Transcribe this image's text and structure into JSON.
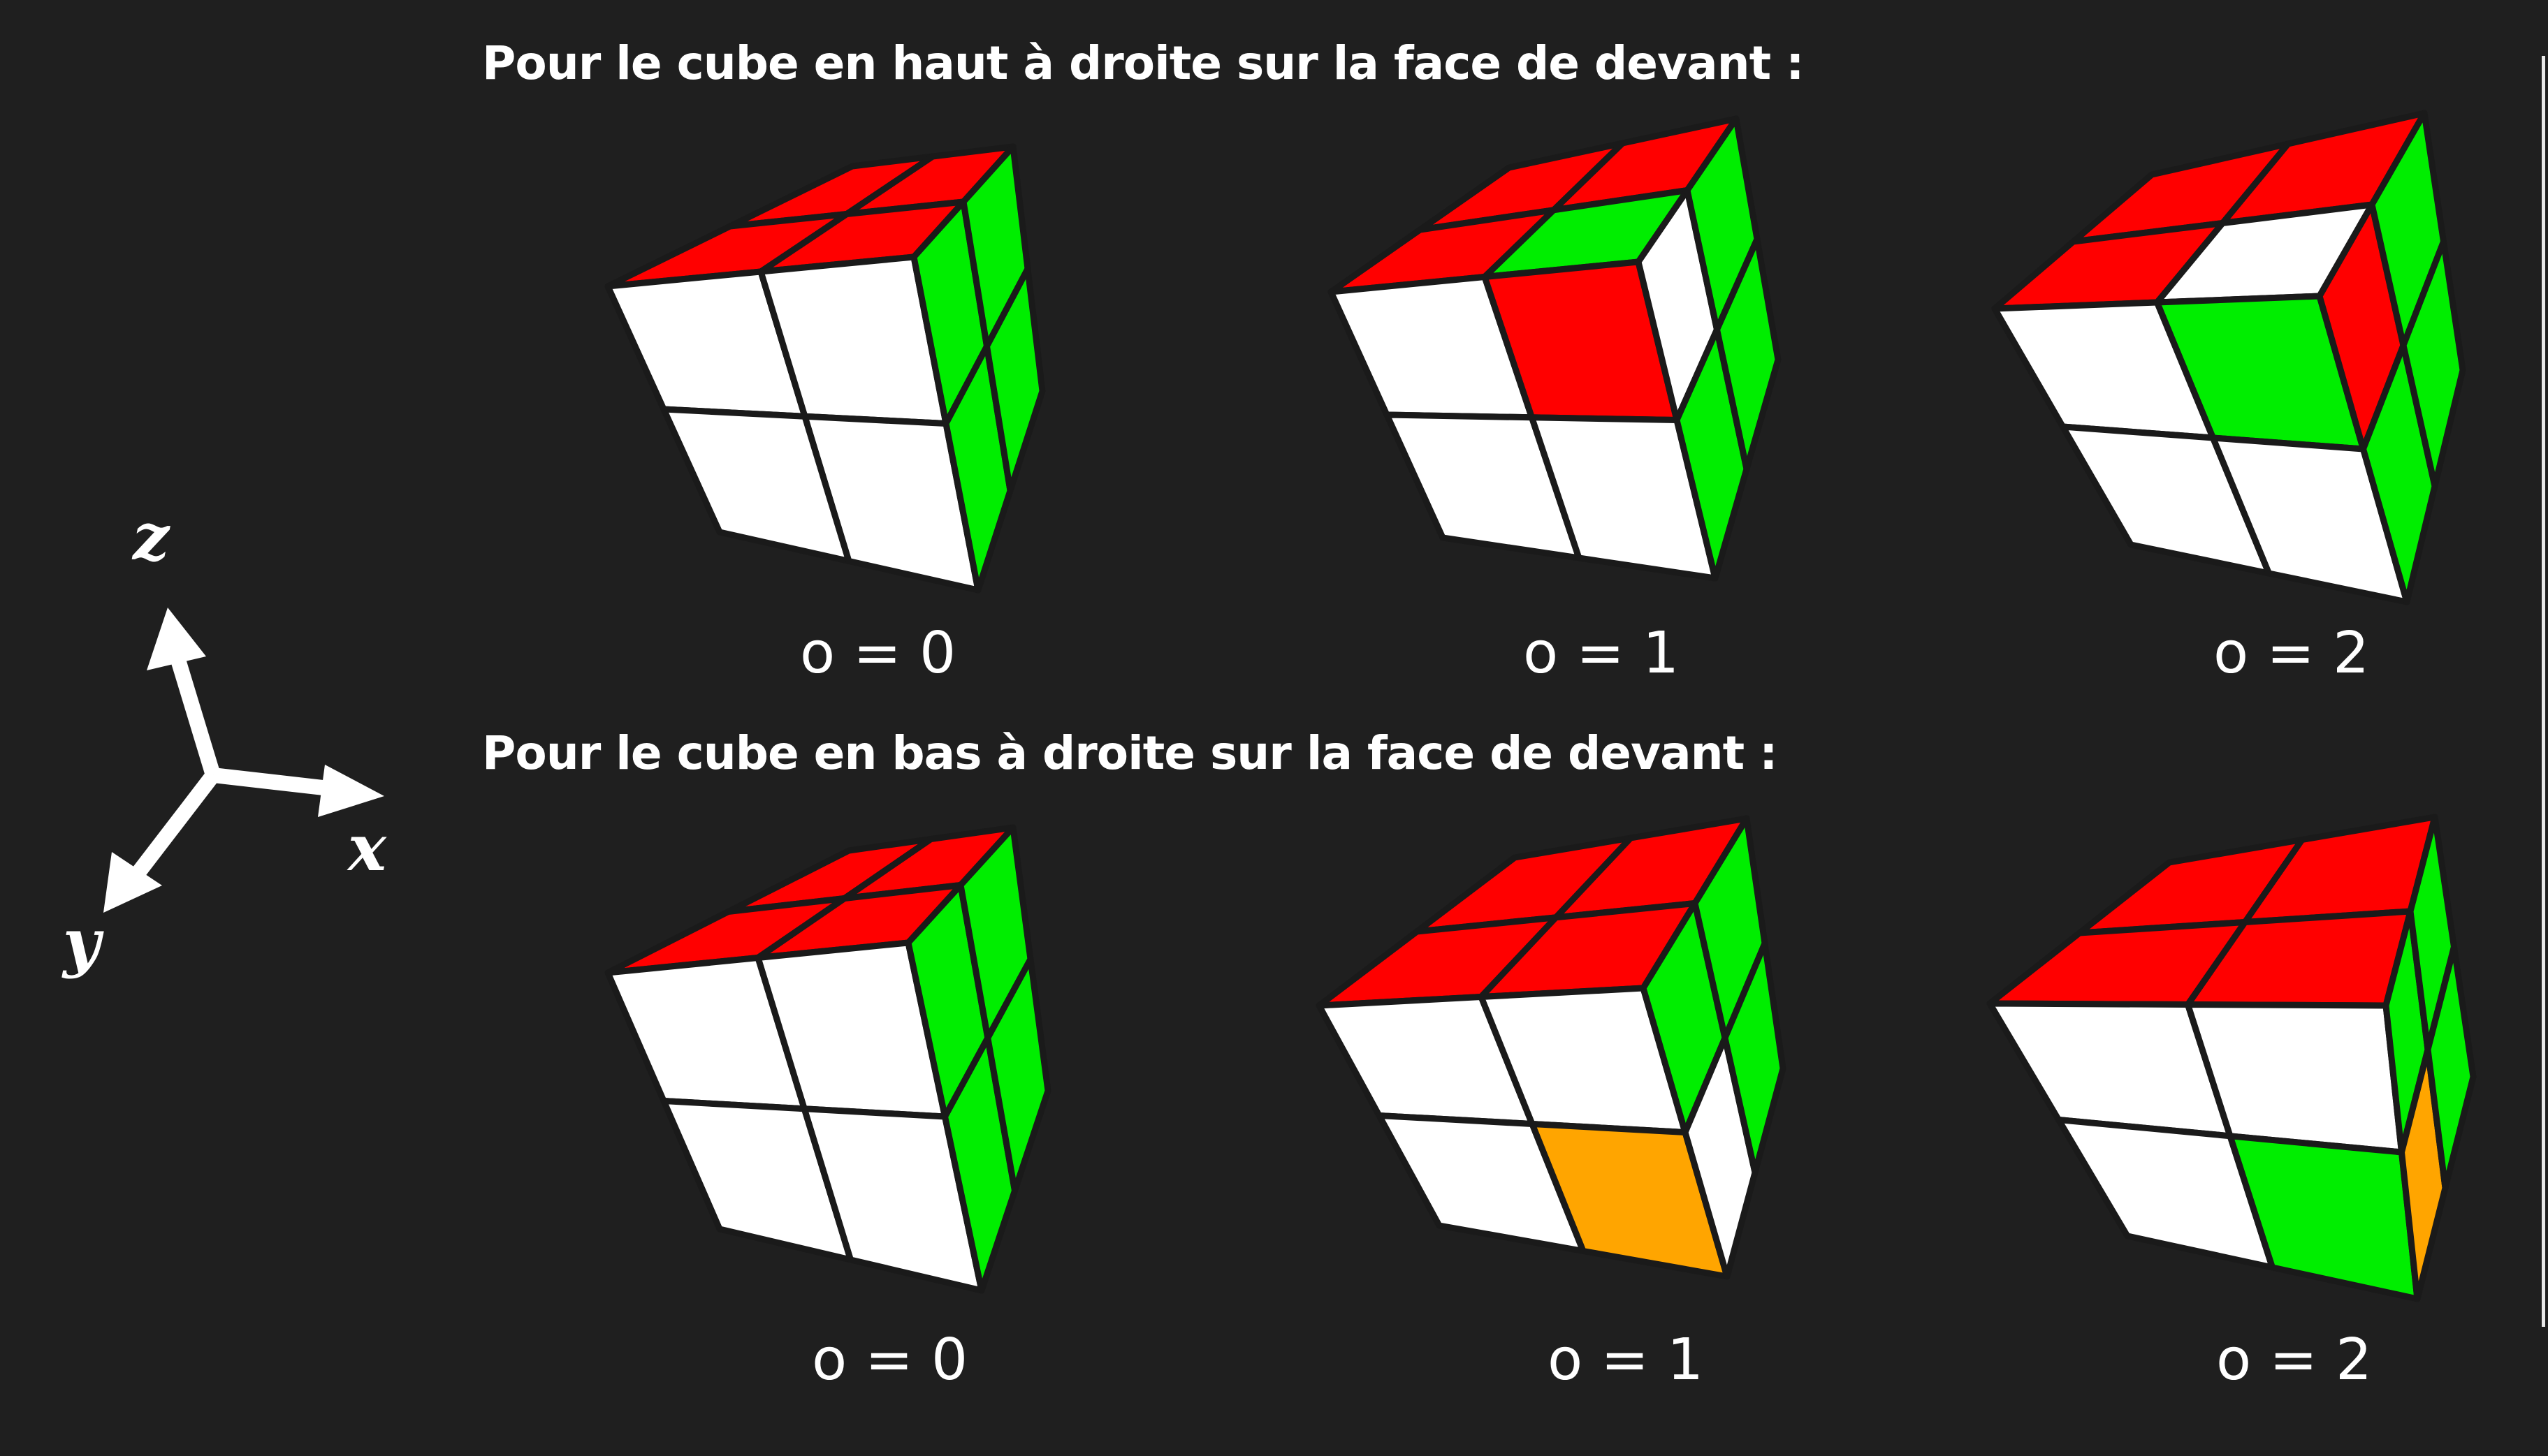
{
  "heading_top": "Pour le cube en haut à droite sur la face de devant :",
  "heading_bottom": "Pour le cube en bas à droite sur la face de devant :",
  "axes": {
    "x": "x",
    "y": "y",
    "z": "z"
  },
  "colors": {
    "red": "#ff0000",
    "green": "#00ee00",
    "white": "#ffffff",
    "orange": "#ffa500",
    "edge": "#1a1a1a"
  },
  "cubes": [
    {
      "label": "o = 0",
      "top": [
        "red",
        "red",
        "red",
        "red"
      ],
      "front": [
        "white",
        "white",
        "white",
        "white"
      ],
      "right": [
        "green",
        "green",
        "green",
        "green"
      ]
    },
    {
      "label": "o = 1",
      "top": [
        "red",
        "red",
        "red",
        "green"
      ],
      "front": [
        "white",
        "red",
        "white",
        "white"
      ],
      "right": [
        "white",
        "green",
        "green",
        "green"
      ]
    },
    {
      "label": "o = 2",
      "top": [
        "red",
        "red",
        "red",
        "white"
      ],
      "front": [
        "white",
        "green",
        "white",
        "white"
      ],
      "right": [
        "red",
        "green",
        "green",
        "green"
      ]
    },
    {
      "label": "o = 0",
      "top": [
        "red",
        "red",
        "red",
        "red"
      ],
      "front": [
        "white",
        "white",
        "white",
        "white"
      ],
      "right": [
        "green",
        "green",
        "green",
        "green"
      ]
    },
    {
      "label": "o = 1",
      "top": [
        "red",
        "red",
        "red",
        "red"
      ],
      "front": [
        "white",
        "white",
        "white",
        "orange"
      ],
      "right": [
        "green",
        "green",
        "white",
        "green"
      ]
    },
    {
      "label": "o = 2",
      "top": [
        "red",
        "red",
        "red",
        "red"
      ],
      "front": [
        "white",
        "white",
        "white",
        "green"
      ],
      "right": [
        "green",
        "green",
        "orange",
        "green"
      ]
    }
  ]
}
